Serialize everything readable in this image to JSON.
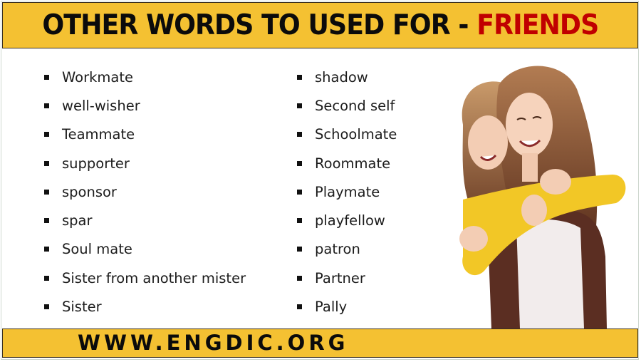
{
  "header": {
    "title_prefix": "OTHER WORDS TO USED FOR - ",
    "title_accent": "FRIENDS",
    "background_color": "#f4c132",
    "accent_color": "#c00000"
  },
  "lists": {
    "column1": [
      "Workmate",
      "well-wisher",
      "Teammate",
      "supporter",
      "sponsor",
      "spar",
      "Soul mate",
      "Sister from another mister",
      "Sister"
    ],
    "column2": [
      "shadow",
      "Second self",
      "Schoolmate",
      "Roommate",
      "Playmate",
      "playfellow",
      "patron",
      "Partner",
      "Pally"
    ]
  },
  "image": {
    "description": "two-smiling-friends-hugging"
  },
  "footer": {
    "url": "WWW.ENGDIC.ORG"
  }
}
